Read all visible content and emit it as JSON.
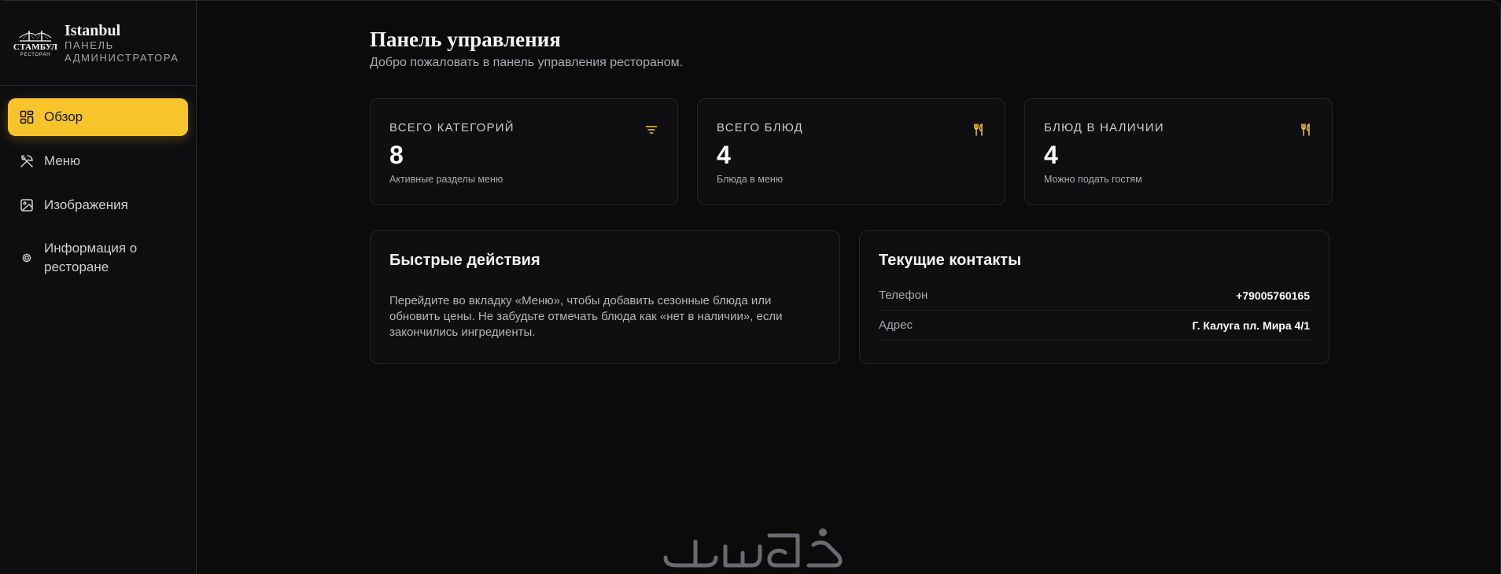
{
  "brand": {
    "logo_main": "СТАМБУЛ",
    "logo_sub": "РЕСТОРАН",
    "name": "Istanbul",
    "role": "Панель администратора"
  },
  "nav": {
    "items": [
      {
        "label": "Обзор",
        "icon": "dashboard-grid-icon",
        "active": true
      },
      {
        "label": "Меню",
        "icon": "utensils-crossed-icon",
        "active": false
      },
      {
        "label": "Изображения",
        "icon": "image-icon",
        "active": false
      },
      {
        "label": "Информация о ресторане",
        "icon": "gear-icon",
        "active": false
      }
    ]
  },
  "header": {
    "title": "Панель управления",
    "subtitle": "Добро пожаловать в панель управления рестораном."
  },
  "stats": [
    {
      "title": "Всего категорий",
      "value": "8",
      "note": "Активные разделы меню",
      "icon": "filter-icon"
    },
    {
      "title": "Всего блюд",
      "value": "4",
      "note": "Блюда в меню",
      "icon": "utensils-icon"
    },
    {
      "title": "Блюд в наличии",
      "value": "4",
      "note": "Можно подать гостям",
      "icon": "utensils-icon"
    }
  ],
  "quick_actions": {
    "title": "Быстрые действия",
    "text": "Перейдите во вкладку «Меню», чтобы добавить сезонные блюда или обновить цены. Не забудьте отмечать блюда как «нет в наличии», если закончились ингредиенты."
  },
  "contacts": {
    "title": "Текущие контакты",
    "rows": [
      {
        "label": "Телефон",
        "value": "+79005760165"
      },
      {
        "label": "Адрес",
        "value": "Г. Калуга пл. Мира 4/1"
      }
    ]
  },
  "colors": {
    "accent": "#f7c52b",
    "background": "#0b0b0c",
    "card": "#0f0f11",
    "border": "#26262a"
  }
}
